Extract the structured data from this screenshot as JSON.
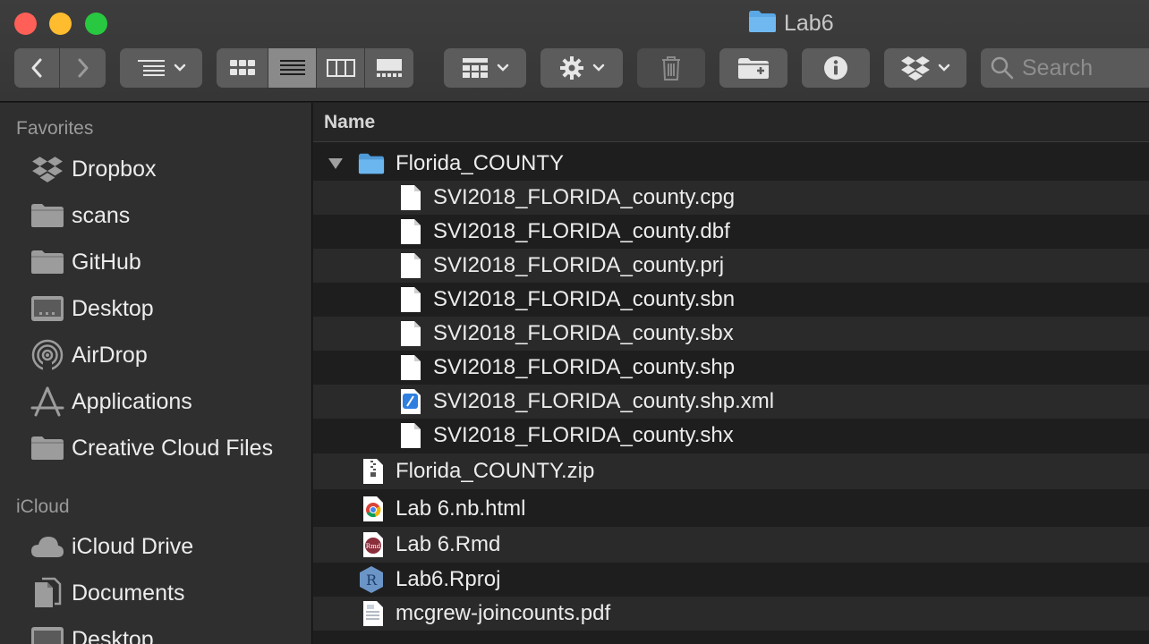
{
  "window": {
    "title": "Lab6",
    "folder_icon": "folder-icon",
    "controls": {
      "close_color": "#fe5f57",
      "minimize_color": "#febc2e",
      "zoom_color": "#28c840"
    }
  },
  "toolbar": {
    "search_placeholder": "Search",
    "view_modes": [
      "icon-view",
      "list-view",
      "column-view",
      "gallery-view"
    ],
    "active_view": "list-view"
  },
  "sidebar": {
    "favorites_label": "Favorites",
    "favorites": [
      {
        "label": "Dropbox",
        "icon": "dropbox-icon"
      },
      {
        "label": "scans",
        "icon": "folder-icon"
      },
      {
        "label": "GitHub",
        "icon": "folder-icon"
      },
      {
        "label": "Desktop",
        "icon": "desktop-icon"
      },
      {
        "label": "AirDrop",
        "icon": "airdrop-icon"
      },
      {
        "label": "Applications",
        "icon": "applications-icon"
      },
      {
        "label": "Creative Cloud Files",
        "icon": "folder-icon"
      }
    ],
    "icloud_label": "iCloud",
    "icloud": [
      {
        "label": "iCloud Drive",
        "icon": "cloud-icon"
      },
      {
        "label": "Documents",
        "icon": "documents-icon"
      },
      {
        "label": "Desktop",
        "icon": "desktop-icon"
      }
    ]
  },
  "list": {
    "column_name": "Name",
    "files": [
      {
        "name": "Florida_COUNTY",
        "icon": "folder-icon",
        "expanded": true,
        "depth": 0
      },
      {
        "name": "SVI2018_FLORIDA_county.cpg",
        "icon": "document-icon",
        "depth": 1
      },
      {
        "name": "SVI2018_FLORIDA_county.dbf",
        "icon": "document-icon",
        "depth": 1
      },
      {
        "name": "SVI2018_FLORIDA_county.prj",
        "icon": "document-icon",
        "depth": 1
      },
      {
        "name": "SVI2018_FLORIDA_county.sbn",
        "icon": "document-icon",
        "depth": 1
      },
      {
        "name": "SVI2018_FLORIDA_county.sbx",
        "icon": "document-icon",
        "depth": 1
      },
      {
        "name": "SVI2018_FLORIDA_county.shp",
        "icon": "document-icon",
        "depth": 1
      },
      {
        "name": "SVI2018_FLORIDA_county.shp.xml",
        "icon": "xml-file-icon",
        "depth": 1
      },
      {
        "name": "SVI2018_FLORIDA_county.shx",
        "icon": "document-icon",
        "depth": 1
      },
      {
        "name": "Florida_COUNTY.zip",
        "icon": "zip-file-icon",
        "depth": 0
      },
      {
        "name": "Lab 6.nb.html",
        "icon": "chrome-html-icon",
        "depth": 0
      },
      {
        "name": "Lab 6.Rmd",
        "icon": "rmd-file-icon",
        "depth": 0
      },
      {
        "name": "Lab6.Rproj",
        "icon": "rproj-file-icon",
        "depth": 0
      },
      {
        "name": "mcgrew-joincounts.pdf",
        "icon": "pdf-file-icon",
        "depth": 0
      }
    ]
  }
}
